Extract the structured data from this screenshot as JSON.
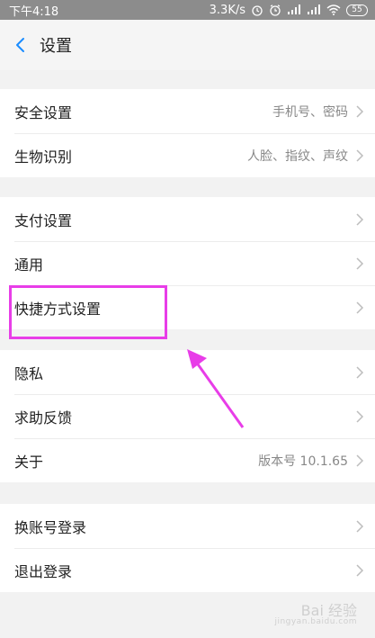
{
  "status_bar": {
    "time": "下午4:18",
    "speed": "3.3K/s",
    "battery": "55"
  },
  "nav": {
    "title": "设置"
  },
  "groups": [
    {
      "items": [
        {
          "label": "安全设置",
          "value": "手机号、密码"
        },
        {
          "label": "生物识别",
          "value": "人脸、指纹、声纹"
        }
      ]
    },
    {
      "items": [
        {
          "label": "支付设置",
          "value": ""
        },
        {
          "label": "通用",
          "value": ""
        },
        {
          "label": "快捷方式设置",
          "value": ""
        }
      ]
    },
    {
      "items": [
        {
          "label": "隐私",
          "value": ""
        },
        {
          "label": "求助反馈",
          "value": ""
        },
        {
          "label": "关于",
          "value": "版本号 10.1.65"
        }
      ]
    },
    {
      "items": [
        {
          "label": "换账号登录",
          "value": ""
        },
        {
          "label": "退出登录",
          "value": ""
        }
      ]
    }
  ],
  "watermark": {
    "main": "Bai 经验",
    "sub": "jingyan.baidu.com"
  },
  "colors": {
    "accent": "#1a8cff",
    "highlight": "#e83de8"
  }
}
